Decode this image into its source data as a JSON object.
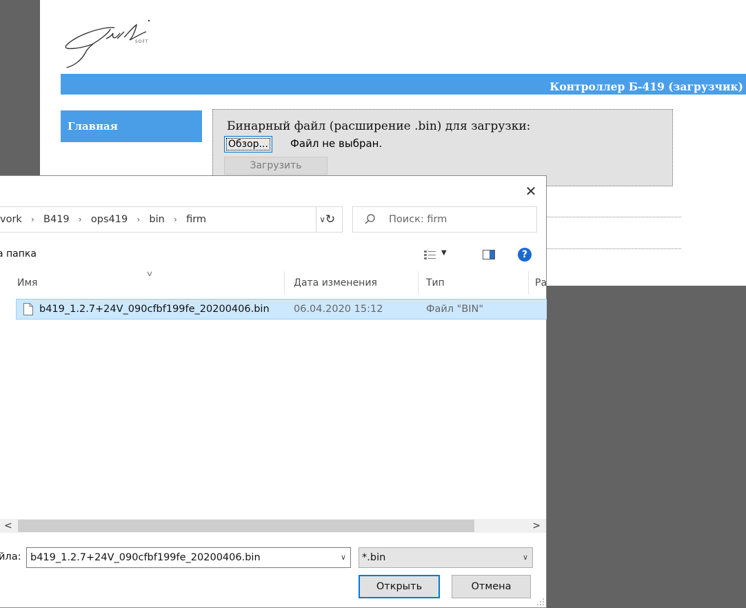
{
  "webpage": {
    "logo_alt": "Stil SOFT",
    "logo_sub": "SOFT",
    "header_title": "Контроллер Б-419 (загрузчик)",
    "nav": [
      {
        "label": "Главная"
      }
    ],
    "upload": {
      "label": "Бинарный файл (расширение .bin) для загрузки:",
      "browse_label": "Обзор...",
      "file_status": "Файл не выбран.",
      "upload_label": "Загрузить"
    }
  },
  "dialog": {
    "close_glyph": "✕",
    "breadcrumb": [
      "vork",
      "B419",
      "ops419",
      "bin",
      "firm"
    ],
    "refresh_glyph": "↻",
    "search_placeholder": "Поиск: firm",
    "new_folder_label": "а папка",
    "help_glyph": "?",
    "columns": {
      "name": "Имя",
      "date": "Дата изменения",
      "type": "Тип",
      "size": "Ра"
    },
    "files": [
      {
        "name": "b419_1.2.7+24V_090cfbf199fe_20200406.bin",
        "date": "06.04.2020 15:12",
        "type": "Файл \"BIN\"",
        "selected": true
      }
    ],
    "filename_label": "йла:",
    "filename_value": "b419_1.2.7+24V_090cfbf199fe_20200406.bin",
    "filetype_value": "*.bin",
    "open_label": "Открыть",
    "cancel_label": "Отмена"
  },
  "colors": {
    "accent_blue": "#4a9ee8",
    "selection": "#cce8ff",
    "background_gray": "#636363"
  },
  "icons": [
    "logo-icon",
    "close-icon",
    "chevron-right-icon",
    "chevron-down-icon",
    "refresh-icon",
    "search-icon",
    "view-options-icon",
    "preview-pane-icon",
    "help-icon",
    "file-icon",
    "scroll-left-icon",
    "scroll-right-icon",
    "resize-grip-icon"
  ]
}
